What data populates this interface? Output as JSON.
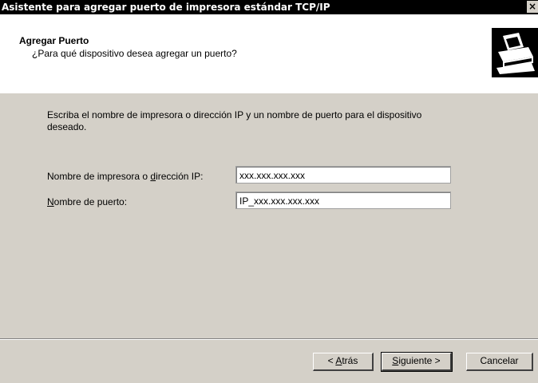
{
  "window": {
    "title": "Asistente para agregar puerto de impresora estándar TCP/IP",
    "close_glyph": "×"
  },
  "header": {
    "title": "Agregar Puerto",
    "subtitle": "¿Para qué dispositivo desea agregar un puerto?",
    "icon": "printer-icon"
  },
  "body": {
    "instruction": "Escriba el nombre de impresora o dirección IP y un nombre de puerto para el dispositivo deseado."
  },
  "form": {
    "printer_label_pre": "Nombre de impresora o ",
    "printer_label_key": "d",
    "printer_label_post": "irección IP:",
    "printer_value": "xxx.xxx.xxx.xxx",
    "port_label_key": "N",
    "port_label_post": "ombre de puerto:",
    "port_value": "IP_xxx.xxx.xxx.xxx"
  },
  "buttons": {
    "back_pre": "< ",
    "back_key": "A",
    "back_post": "trás",
    "next_key": "S",
    "next_post": "iguiente >",
    "cancel": "Cancelar"
  }
}
